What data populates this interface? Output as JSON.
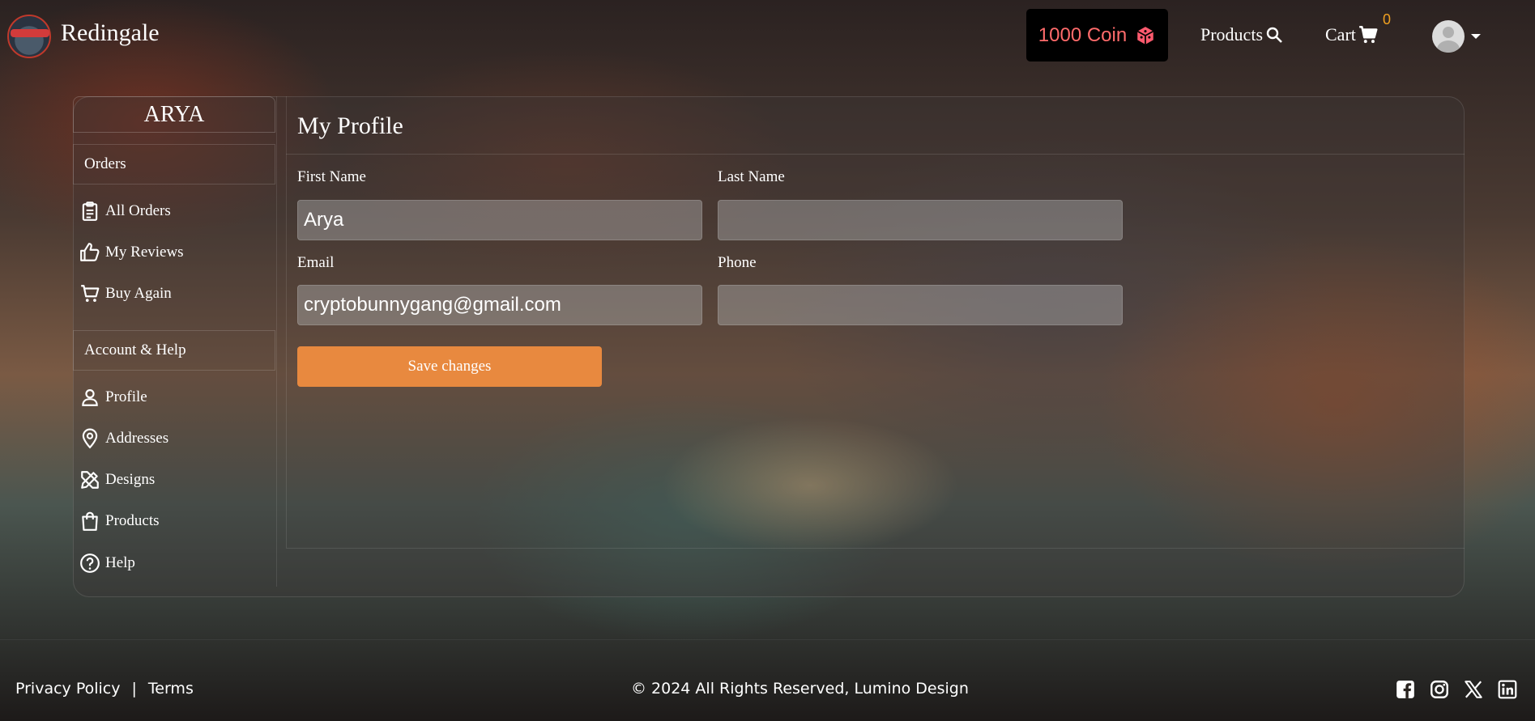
{
  "header": {
    "brand": "Redingale",
    "coin_label": "1000 Coin",
    "nav_products": "Products",
    "nav_cart": "Cart",
    "cart_count": "0"
  },
  "sidebar": {
    "user_name": "ARYA",
    "section_orders": "Orders",
    "items_orders": [
      {
        "label": "All Orders",
        "icon": "clipboard-icon"
      },
      {
        "label": "My Reviews",
        "icon": "thumbs-up-icon"
      },
      {
        "label": "Buy Again",
        "icon": "cart-icon"
      }
    ],
    "section_account": "Account & Help",
    "items_account": [
      {
        "label": "Profile",
        "icon": "person-icon"
      },
      {
        "label": "Addresses",
        "icon": "map-pin-icon"
      },
      {
        "label": "Designs",
        "icon": "design-tools-icon"
      },
      {
        "label": "Products",
        "icon": "shopping-bag-icon"
      },
      {
        "label": "Help",
        "icon": "help-circle-icon"
      }
    ]
  },
  "profile": {
    "title": "My Profile",
    "first_name_label": "First Name",
    "first_name_value": "Arya",
    "last_name_label": "Last Name",
    "last_name_value": "",
    "email_label": "Email",
    "email_value": "cryptobunnygang@gmail.com",
    "phone_label": "Phone",
    "phone_value": "",
    "save_label": "Save changes"
  },
  "footer": {
    "privacy": "Privacy Policy",
    "separator": "|",
    "terms": "Terms",
    "copyright": "© 2024 All Rights Reserved, Lumino Design"
  },
  "colors": {
    "accent_button": "#e8893f",
    "coin_text": "#ff6b6b",
    "cart_badge": "#f0a020"
  }
}
